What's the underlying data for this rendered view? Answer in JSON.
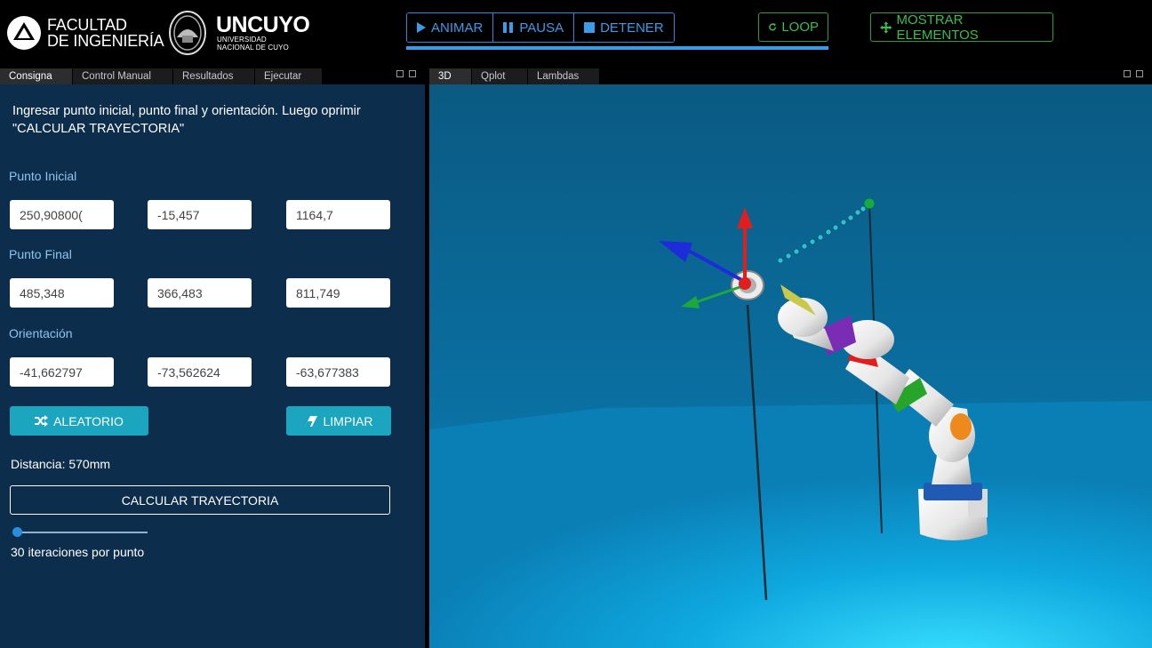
{
  "header": {
    "faculty_line1": "FACULTAD",
    "faculty_line2": "DE INGENIERÍA",
    "university_name": "UNCUYO",
    "university_sub1": "UNIVERSIDAD",
    "university_sub2": "NACIONAL DE CUYO",
    "animar_label": "ANIMAR",
    "pausa_label": "PAUSA",
    "detener_label": "DETENER",
    "loop_label": "LOOP",
    "mostrar_label": "MOSTRAR ELEMENTOS",
    "animation_progress": 1.0
  },
  "left_tabs": [
    "Consigna",
    "Control Manual",
    "Resultados",
    "Ejecutar"
  ],
  "right_tabs": [
    "3D",
    "Qplot",
    "Lambdas"
  ],
  "consigna": {
    "instruction": "Ingresar punto inicial, punto final y orientación. Luego oprimir \"CALCULAR TRAYECTORIA\"",
    "punto_inicial_label": "Punto Inicial",
    "punto_inicial": [
      "250,90800(",
      "-15,457",
      "1164,7"
    ],
    "punto_final_label": "Punto Final",
    "punto_final": [
      "485,348",
      "366,483",
      "811,749"
    ],
    "orientacion_label": "Orientación",
    "orientacion": [
      "-41,662797",
      "-73,562624",
      "-63,677383"
    ],
    "aleatorio_label": "ALEATORIO",
    "limpiar_label": "LIMPIAR",
    "distancia": "Distancia: 570mm",
    "calcular_label": "CALCULAR TRAYECTORIA",
    "iteraciones_label": "30 iteraciones por punto",
    "iteraciones_slider_value": 0
  },
  "icons": {
    "play": "play-icon",
    "pause": "pause-icon",
    "stop": "stop-icon",
    "loop": "refresh-icon",
    "mostrar": "move-icon",
    "aleatorio": "shuffle-icon",
    "limpiar": "eraser-icon"
  },
  "colors": {
    "accent_blue": "#3a9be8",
    "accent_green": "#3bbd4f",
    "panel_bg": "#0d2d4c",
    "teal_button": "#1ba5bf"
  }
}
